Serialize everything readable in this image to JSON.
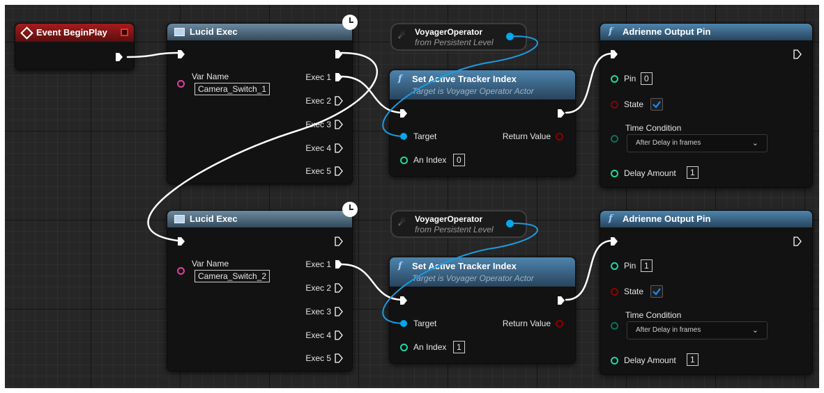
{
  "event_node": {
    "title": "Event BeginPlay"
  },
  "lucid_exec": [
    {
      "title": "Lucid Exec",
      "var_name_label": "Var Name",
      "var_name_value": "Camera_Switch_1",
      "outputs": [
        "Exec 1",
        "Exec 2",
        "Exec 3",
        "Exec 4",
        "Exec 5"
      ]
    },
    {
      "title": "Lucid Exec",
      "var_name_label": "Var Name",
      "var_name_value": "Camera_Switch_2",
      "outputs": [
        "Exec 1",
        "Exec 2",
        "Exec 3",
        "Exec 4",
        "Exec 5"
      ]
    }
  ],
  "voyager_ref": [
    {
      "title": "VoyagerOperator",
      "subtitle": "from Persistent Level"
    },
    {
      "title": "VoyagerOperator",
      "subtitle": "from Persistent Level"
    }
  ],
  "set_tracker": [
    {
      "title": "Set Active Tracker Index",
      "subtitle": "Target is Voyager Operator Actor",
      "target_label": "Target",
      "return_label": "Return Value",
      "index_label": "An Index",
      "index_value": "0"
    },
    {
      "title": "Set Active Tracker Index",
      "subtitle": "Target is Voyager Operator Actor",
      "target_label": "Target",
      "return_label": "Return Value",
      "index_label": "An Index",
      "index_value": "1"
    }
  ],
  "adrienne": [
    {
      "title": "Adrienne Output Pin",
      "pin_label": "Pin",
      "pin_value": "0",
      "state_label": "State",
      "state_checked": true,
      "time_condition_label": "Time Condition",
      "time_condition_value": "After Delay in frames",
      "delay_label": "Delay Amount",
      "delay_value": "1"
    },
    {
      "title": "Adrienne Output Pin",
      "pin_label": "Pin",
      "pin_value": "1",
      "state_label": "State",
      "state_checked": true,
      "time_condition_label": "Time Condition",
      "time_condition_value": "After Delay in frames",
      "delay_label": "Delay Amount",
      "delay_value": "1"
    }
  ],
  "colors": {
    "event_header": "#8b1414",
    "lucid_header": "#5d7a8e",
    "function_header": "#4b7ea6",
    "exec_wire": "#ffffff",
    "object_pin": "#00a8f0",
    "int_pin": "#1fd8a3",
    "bool_pin": "#8d0000",
    "string_pin": "#e0409e",
    "checkbox_tick": "#1b8cff"
  }
}
